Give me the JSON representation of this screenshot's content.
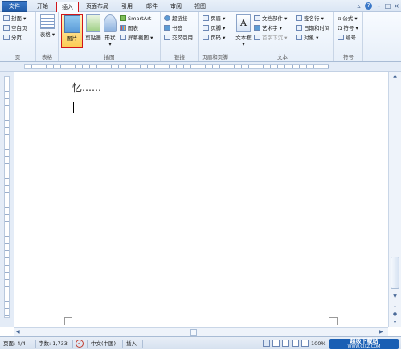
{
  "tabs": [
    {
      "label": "文件"
    },
    {
      "label": "开始"
    },
    {
      "label": "插入"
    },
    {
      "label": "页面布局"
    },
    {
      "label": "引用"
    },
    {
      "label": "邮件"
    },
    {
      "label": "审阅"
    },
    {
      "label": "视图"
    }
  ],
  "ribbon": {
    "pages": {
      "items": [
        "封面",
        "空白页",
        "分页"
      ],
      "label": "页"
    },
    "table": {
      "button": "表格",
      "label": "表格"
    },
    "illustrations": {
      "picture": "图片",
      "clipart": "剪贴画",
      "shapes": "形状",
      "smartart": "SmartArt",
      "chart": "图表",
      "screenshot": "屏幕截图",
      "label": "插图"
    },
    "links": {
      "items": [
        "超链接",
        "书签",
        "交叉引用"
      ],
      "label": "链接"
    },
    "header_footer": {
      "items": [
        "页眉",
        "页脚",
        "页码"
      ],
      "label": "页眉和页脚"
    },
    "text": {
      "textbox": "文本框",
      "items": [
        "文档部件",
        "艺术字",
        "首字下沉",
        "签名行",
        "日期和时间",
        "对象"
      ],
      "label": "文本"
    },
    "symbols": {
      "items": [
        "公式",
        "符号",
        "编号"
      ],
      "label": "符号"
    }
  },
  "document": {
    "text": "忆……"
  },
  "status": {
    "page": "页面: 4/4",
    "words": "字数: 1,733",
    "language": "中文(中国)",
    "mode": "插入",
    "zoom": "100%"
  },
  "watermark": {
    "line1": "超级下载站",
    "line2": "WWW.CJXZ.COM"
  }
}
